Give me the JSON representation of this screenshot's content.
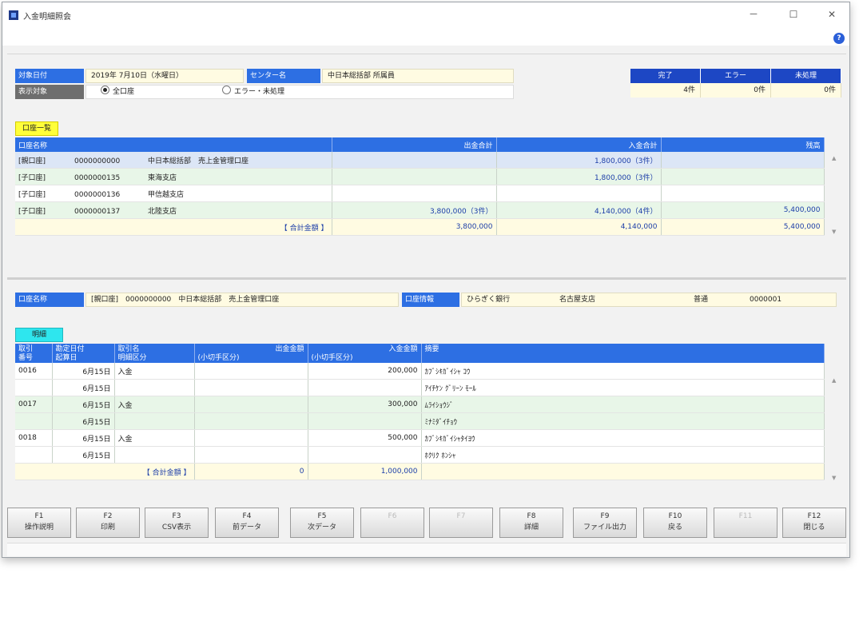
{
  "window": {
    "title": "入金明細照会",
    "minimize": "－",
    "maximize": "☐",
    "close": "✕",
    "help": "?"
  },
  "header": {
    "date_label": "対象日付",
    "date_value": "2019年 7月10日（水曜日）",
    "center_label": "センター名",
    "center_value": "中日本総括部 所属員",
    "display_label": "表示対象",
    "radio_all": "全口座",
    "radio_error": "エラー・未処理"
  },
  "status": {
    "headers": [
      "完了",
      "エラー",
      "未処理"
    ],
    "values": [
      "4件",
      "0件",
      "0件"
    ]
  },
  "accounts_tag": "口座一覧",
  "accounts": {
    "columns": [
      "口座名称",
      "出金合計",
      "入金合計",
      "残高"
    ],
    "rows": [
      {
        "type": "[親口座]",
        "number": "0000000000",
        "name": "中日本総括部　売上金管理口座",
        "out": "",
        "in": "1,800,000（3件）",
        "bal": ""
      },
      {
        "type": "[子口座]",
        "number": "0000000135",
        "name": "東海支店",
        "out": "",
        "in": "1,800,000（3件）",
        "bal": ""
      },
      {
        "type": "[子口座]",
        "number": "0000000136",
        "name": "甲信越支店",
        "out": "",
        "in": "",
        "bal": ""
      },
      {
        "type": "[子口座]",
        "number": "0000000137",
        "name": "北陸支店",
        "out": "3,800,000（3件）",
        "in": "4,140,000（4件）",
        "bal": "5,400,000"
      }
    ],
    "total_label": "【 合計金額 】",
    "total": {
      "out": "3,800,000",
      "in": "4,140,000",
      "bal": "5,400,000"
    }
  },
  "detail": {
    "account_label": "口座名称",
    "account_value": "[親口座]　0000000000　中日本総括部　売上金管理口座",
    "bank_label": "口座情報",
    "bank": "ひらぎく銀行",
    "branch": "名古屋支店",
    "kind": "普通",
    "acct_no": "0000001"
  },
  "details_tag": "明細",
  "details": {
    "columns": [
      {
        "l1": "取引",
        "l2": "番号"
      },
      {
        "l1": "勘定日付",
        "l2": "起算日"
      },
      {
        "l1": "取引名",
        "l2": "明細区分"
      },
      {
        "l1": "出金金額",
        "l2": "(小切手区分)"
      },
      {
        "l1": "入金金額",
        "l2": "(小切手区分)"
      },
      {
        "l1": "摘要",
        "l2": ""
      }
    ],
    "rows": [
      {
        "no": "0016",
        "date1": "6月15日",
        "date2": "6月15日",
        "name": "入金",
        "out": "",
        "in": "200,000",
        "memo1": "ｶﾌﾞｼｷｶﾞｲｼｬ ｺｳ",
        "memo2": "ｱｲﾁｹﾝ ｸﾞﾘｰﾝ ﾓｰﾙ"
      },
      {
        "no": "0017",
        "date1": "6月15日",
        "date2": "6月15日",
        "name": "入金",
        "out": "",
        "in": "300,000",
        "memo1": "ﾑﾗｲｼｮｳｼﾞ",
        "memo2": "ﾐﾅﾐﾀﾞｲﾁｮｳ"
      },
      {
        "no": "0018",
        "date1": "6月15日",
        "date2": "6月15日",
        "name": "入金",
        "out": "",
        "in": "500,000",
        "memo1": "ｶﾌﾞｼｷｶﾞｲｼｬﾀｲﾖｳ",
        "memo2": "ﾎｸﾘｸ ﾎﾝｼｬ"
      }
    ],
    "total_label": "【 合計金額 】",
    "total": {
      "out": "0",
      "in": "1,000,000"
    }
  },
  "fkeys": [
    {
      "key": "F1",
      "label": "操作説明",
      "enabled": true
    },
    {
      "key": "F2",
      "label": "印刷",
      "enabled": true
    },
    {
      "key": "F3",
      "label": "CSV表示",
      "enabled": true
    },
    {
      "key": "F4",
      "label": "前データ",
      "enabled": true
    },
    {
      "key": "F5",
      "label": "次データ",
      "enabled": true
    },
    {
      "key": "F6",
      "label": "",
      "enabled": false
    },
    {
      "key": "F7",
      "label": "",
      "enabled": false
    },
    {
      "key": "F8",
      "label": "詳細",
      "enabled": true
    },
    {
      "key": "F9",
      "label": "ファイル出力",
      "enabled": true
    },
    {
      "key": "F10",
      "label": "戻る",
      "enabled": true
    },
    {
      "key": "F11",
      "label": "",
      "enabled": false
    },
    {
      "key": "F12",
      "label": "閉じる",
      "enabled": true
    }
  ]
}
